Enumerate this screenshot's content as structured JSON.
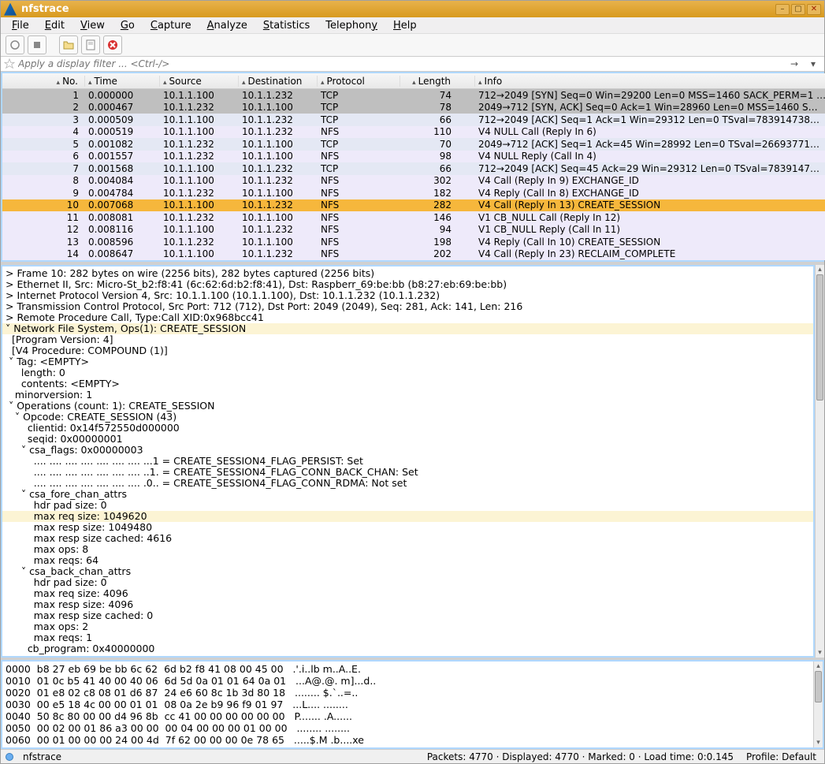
{
  "title": "nfstrace",
  "menus": {
    "file": "File",
    "edit": "Edit",
    "view": "View",
    "go": "Go",
    "capture": "Capture",
    "analyze": "Analyze",
    "statistics": "Statistics",
    "telephony": "Telephony",
    "help": "Help"
  },
  "filter_placeholder": "Apply a display filter ... <Ctrl-/>",
  "columns": {
    "no": "No.",
    "time": "Time",
    "source": "Source",
    "destination": "Destination",
    "protocol": "Protocol",
    "length": "Length",
    "info": "Info"
  },
  "packets": [
    {
      "no": 1,
      "time": "0.000000",
      "src": "10.1.1.100",
      "dst": "10.1.1.232",
      "proto": "TCP",
      "len": 74,
      "info": "712→2049 [SYN] Seq=0 Win=29200 Len=0 MSS=1460 SACK_PERM=1 …",
      "cls": "row-selgrey"
    },
    {
      "no": 2,
      "time": "0.000467",
      "src": "10.1.1.232",
      "dst": "10.1.1.100",
      "proto": "TCP",
      "len": 78,
      "info": "2049→712 [SYN, ACK] Seq=0 Ack=1 Win=28960 Len=0 MSS=1460 S…",
      "cls": "row-selgrey"
    },
    {
      "no": 3,
      "time": "0.000509",
      "src": "10.1.1.100",
      "dst": "10.1.1.232",
      "proto": "TCP",
      "len": 66,
      "info": "712→2049 [ACK] Seq=1 Ack=1 Win=29312 Len=0 TSval=783914738…",
      "cls": "row-tcp"
    },
    {
      "no": 4,
      "time": "0.000519",
      "src": "10.1.1.100",
      "dst": "10.1.1.232",
      "proto": "NFS",
      "len": 110,
      "info": "V4 NULL Call (Reply In 6)",
      "cls": "row-lavender"
    },
    {
      "no": 5,
      "time": "0.001082",
      "src": "10.1.1.232",
      "dst": "10.1.1.100",
      "proto": "TCP",
      "len": 70,
      "info": "2049→712 [ACK] Seq=1 Ack=45 Win=28992 Len=0 TSval=26693771…",
      "cls": "row-tcp"
    },
    {
      "no": 6,
      "time": "0.001557",
      "src": "10.1.1.232",
      "dst": "10.1.1.100",
      "proto": "NFS",
      "len": 98,
      "info": "V4 NULL Reply (Call In 4)",
      "cls": "row-lavender"
    },
    {
      "no": 7,
      "time": "0.001568",
      "src": "10.1.1.100",
      "dst": "10.1.1.232",
      "proto": "TCP",
      "len": 66,
      "info": "712→2049 [ACK] Seq=45 Ack=29 Win=29312 Len=0 TSval=7839147…",
      "cls": "row-tcp"
    },
    {
      "no": 8,
      "time": "0.004084",
      "src": "10.1.1.100",
      "dst": "10.1.1.232",
      "proto": "NFS",
      "len": 302,
      "info": "V4 Call (Reply In 9) EXCHANGE_ID",
      "cls": "row-lavender"
    },
    {
      "no": 9,
      "time": "0.004784",
      "src": "10.1.1.232",
      "dst": "10.1.1.100",
      "proto": "NFS",
      "len": 182,
      "info": "V4 Reply (Call In 8) EXCHANGE_ID",
      "cls": "row-lavender"
    },
    {
      "no": 10,
      "time": "0.007068",
      "src": "10.1.1.100",
      "dst": "10.1.1.232",
      "proto": "NFS",
      "len": 282,
      "info": "V4 Call (Reply In 13) CREATE_SESSION",
      "cls": "row-sel"
    },
    {
      "no": 11,
      "time": "0.008081",
      "src": "10.1.1.232",
      "dst": "10.1.1.100",
      "proto": "NFS",
      "len": 146,
      "info": "V1 CB_NULL Call (Reply In 12)",
      "cls": "row-lavender"
    },
    {
      "no": 12,
      "time": "0.008116",
      "src": "10.1.1.100",
      "dst": "10.1.1.232",
      "proto": "NFS",
      "len": 94,
      "info": "V1 CB_NULL Reply (Call In 11)",
      "cls": "row-lavender"
    },
    {
      "no": 13,
      "time": "0.008596",
      "src": "10.1.1.232",
      "dst": "10.1.1.100",
      "proto": "NFS",
      "len": 198,
      "info": "V4 Reply (Call In 10) CREATE_SESSION",
      "cls": "row-lavender"
    },
    {
      "no": 14,
      "time": "0.008647",
      "src": "10.1.1.100",
      "dst": "10.1.1.232",
      "proto": "NFS",
      "len": 202,
      "info": "V4 Call (Reply In 23) RECLAIM_COMPLETE",
      "cls": "row-lavender"
    }
  ],
  "tree": [
    {
      "t": "> Frame 10: 282 bytes on wire (2256 bits), 282 bytes captured (2256 bits)",
      "i": 0
    },
    {
      "t": "> Ethernet II, Src: Micro-St_b2:f8:41 (6c:62:6d:b2:f8:41), Dst: Raspberr_69:be:bb (b8:27:eb:69:be:bb)",
      "i": 0
    },
    {
      "t": "> Internet Protocol Version 4, Src: 10.1.1.100 (10.1.1.100), Dst: 10.1.1.232 (10.1.1.232)",
      "i": 0
    },
    {
      "t": "> Transmission Control Protocol, Src Port: 712 (712), Dst Port: 2049 (2049), Seq: 281, Ack: 141, Len: 216",
      "i": 0
    },
    {
      "t": "> Remote Procedure Call, Type:Call XID:0x968bcc41",
      "i": 0
    },
    {
      "t": "˅ Network File System, Ops(1): CREATE_SESSION",
      "i": 0,
      "hl": true
    },
    {
      "t": "  [Program Version: 4]",
      "i": 0
    },
    {
      "t": "  [V4 Procedure: COMPOUND (1)]",
      "i": 0
    },
    {
      "t": " ˅ Tag: <EMPTY>",
      "i": 0
    },
    {
      "t": "     length: 0",
      "i": 0
    },
    {
      "t": "     contents: <EMPTY>",
      "i": 0
    },
    {
      "t": "   minorversion: 1",
      "i": 0
    },
    {
      "t": " ˅ Operations (count: 1): CREATE_SESSION",
      "i": 0
    },
    {
      "t": "   ˅ Opcode: CREATE_SESSION (43)",
      "i": 0
    },
    {
      "t": "       clientid: 0x14f572550d000000",
      "i": 0
    },
    {
      "t": "       seqid: 0x00000001",
      "i": 0
    },
    {
      "t": "     ˅ csa_flags: 0x00000003",
      "i": 0
    },
    {
      "t": "         .... .... .... .... .... .... .... ...1 = CREATE_SESSION4_FLAG_PERSIST: Set",
      "i": 0
    },
    {
      "t": "         .... .... .... .... .... .... .... ..1. = CREATE_SESSION4_FLAG_CONN_BACK_CHAN: Set",
      "i": 0
    },
    {
      "t": "         .... .... .... .... .... .... .... .0.. = CREATE_SESSION4_FLAG_CONN_RDMA: Not set",
      "i": 0
    },
    {
      "t": "     ˅ csa_fore_chan_attrs",
      "i": 0
    },
    {
      "t": "         hdr pad size: 0",
      "i": 0
    },
    {
      "t": "         max req size: 1049620",
      "i": 0,
      "hl": true
    },
    {
      "t": "         max resp size: 1049480",
      "i": 0
    },
    {
      "t": "         max resp size cached: 4616",
      "i": 0
    },
    {
      "t": "         max ops: 8",
      "i": 0
    },
    {
      "t": "         max reqs: 64",
      "i": 0
    },
    {
      "t": "     ˅ csa_back_chan_attrs",
      "i": 0
    },
    {
      "t": "         hdr pad size: 0",
      "i": 0
    },
    {
      "t": "         max req size: 4096",
      "i": 0
    },
    {
      "t": "         max resp size: 4096",
      "i": 0
    },
    {
      "t": "         max resp size cached: 0",
      "i": 0
    },
    {
      "t": "         max ops: 2",
      "i": 0
    },
    {
      "t": "         max reqs: 1",
      "i": 0
    },
    {
      "t": "       cb_program: 0x40000000",
      "i": 0
    }
  ],
  "hex": [
    "0000  b8 27 eb 69 be bb 6c 62  6d b2 f8 41 08 00 45 00   .'.i..lb m..A..E.",
    "0010  01 0c b5 41 40 00 40 06  6d 5d 0a 01 01 64 0a 01   ...A@.@. m]...d..",
    "0020  01 e8 02 c8 08 01 d6 87  24 e6 60 8c 1b 3d 80 18   ........ $.`..=..",
    "0030  00 e5 18 4c 00 00 01 01  08 0a 2e b9 96 f9 01 97   ...L.... ........",
    "0040  50 8c 80 00 00 d4 96 8b  cc 41 00 00 00 00 00 00   P....... .A......",
    "0050  00 02 00 01 86 a3 00 00  00 04 00 00 00 01 00 00   ........ ........",
    "0060  00 01 00 00 00 24 00 4d  7f 62 00 00 00 0e 78 65   .....$.M .b....xe"
  ],
  "status": {
    "file": "nfstrace",
    "packets": "Packets: 4770 · Displayed: 4770 · Marked: 0 · Load time: 0:0.145",
    "profile": "Profile: Default"
  }
}
